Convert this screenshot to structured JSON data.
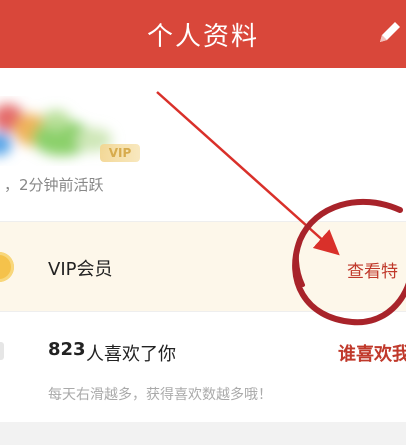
{
  "header": {
    "title": "个人资料",
    "background_color": "#d9473a",
    "edit_icon": "pencil-icon"
  },
  "profile": {
    "vip_badge": "VIP",
    "status": "，2分钟前活跃"
  },
  "vip_row": {
    "label": "VIP会员",
    "link": "查看特",
    "icon": "vip-coin-icon"
  },
  "likes_row": {
    "count": "823",
    "text": "人喜欢了你",
    "who_likes": "谁喜欢我",
    "tip": "每天右滑越多，获得喜欢数越多哦！"
  },
  "annotation": {
    "color": "#d9302a"
  }
}
